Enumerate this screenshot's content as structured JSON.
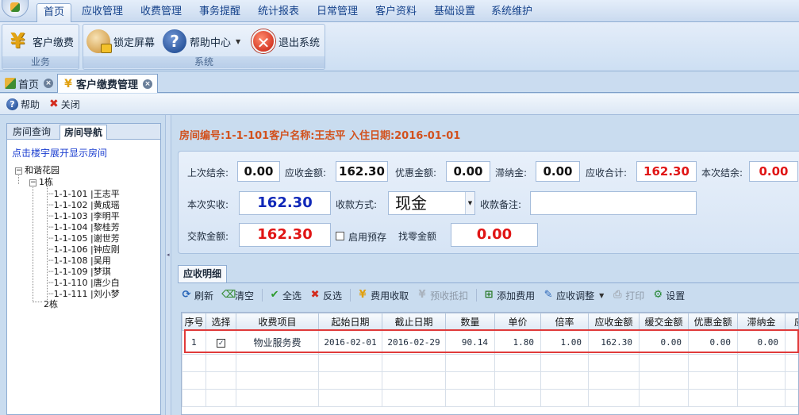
{
  "menu": {
    "tabs": [
      "首页",
      "应收管理",
      "收费管理",
      "事务提醒",
      "统计报表",
      "日常管理",
      "客户资料",
      "基础设置",
      "系统维护"
    ],
    "active_index": 0
  },
  "ribbon": {
    "business_group": {
      "label": "业务",
      "buttons": [
        "客户缴费"
      ]
    },
    "system_group": {
      "label": "系统",
      "buttons": [
        "锁定屏幕",
        "帮助中心",
        "退出系统"
      ]
    }
  },
  "doc_tabs": [
    {
      "label": "首页",
      "active": false
    },
    {
      "label": "客户缴费管理",
      "active": true
    }
  ],
  "toolbar": {
    "help": "帮助",
    "close": "关闭"
  },
  "left_panel": {
    "tabs": [
      "房间查询",
      "房间导航"
    ],
    "active_tab": 1,
    "hint": "点击楼宇展开显示房间",
    "tree": {
      "root": "和谐花园",
      "buildings": [
        {
          "name": "1栋",
          "rooms": [
            "1-1-101 |王志平",
            "1-1-102 |黄成瑶",
            "1-1-103 |李明平",
            "1-1-104 |黎桂芳",
            "1-1-105 |谢世芳",
            "1-1-106 |钟应刚",
            "1-1-108 |吴用",
            "1-1-109 |梦琪",
            "1-1-110 |唐少白",
            "1-1-111 |刘小梦"
          ]
        },
        {
          "name": "2栋",
          "rooms": []
        }
      ]
    }
  },
  "room_info": "房间编号:1-1-101客户名称:王志平 入住日期:2016-01-01",
  "form": {
    "last_balance": {
      "label": "上次结余:",
      "value": "0.00"
    },
    "receivable": {
      "label": "应收金额:",
      "value": "162.30"
    },
    "discount": {
      "label": "优惠金额:",
      "value": "0.00"
    },
    "late_fee": {
      "label": "滞纳金:",
      "value": "0.00"
    },
    "total_due": {
      "label": "应收合计:",
      "value": "162.30"
    },
    "this_balance": {
      "label": "本次结余:",
      "value": "0.00"
    },
    "actual_received": {
      "label": "本次实收:",
      "value": "162.30"
    },
    "payment_method": {
      "label": "收款方式:",
      "value": "现金"
    },
    "remark": {
      "label": "收款备注:",
      "value": ""
    },
    "paid_amount": {
      "label": "交款金额:",
      "value": "162.30"
    },
    "enable_prepay": {
      "label": "启用预存",
      "checked": false
    },
    "change": {
      "label": "找零金额",
      "value": "0.00"
    }
  },
  "detail": {
    "tab_label": "应收明细",
    "toolbar": [
      "刷新",
      "清空",
      "全选",
      "反选",
      "费用收取",
      "预收抵扣",
      "添加费用",
      "应收调整",
      "打印",
      "设置"
    ],
    "columns": [
      "序号",
      "选择",
      "收费项目",
      "起始日期",
      "截止日期",
      "数量",
      "单价",
      "倍率",
      "应收金额",
      "缓交金额",
      "优惠金额",
      "滞纳金",
      "应"
    ],
    "rows": [
      {
        "index": "1",
        "selected": "✓",
        "item": "物业服务费",
        "start": "2016-02-01",
        "end": "2016-02-29",
        "qty": "90.14",
        "price": "1.80",
        "rate": "1.00",
        "due": "162.30",
        "deferred": "0.00",
        "discount": "0.00",
        "late": "0.00"
      }
    ]
  },
  "colors": {
    "highlight": "#e03a3a",
    "title": "#d2511d",
    "red_value": "#e01515",
    "blue_value": "#1028b8"
  },
  "icons": [
    "yen-icon",
    "lock-user-icon",
    "help-icon",
    "exit-icon",
    "home-icon",
    "close-icon",
    "refresh-icon",
    "clear-icon",
    "check-all-icon",
    "invert-icon",
    "charge-icon",
    "prepay-icon",
    "add-fee-icon",
    "adjust-icon",
    "print-icon",
    "settings-icon"
  ]
}
